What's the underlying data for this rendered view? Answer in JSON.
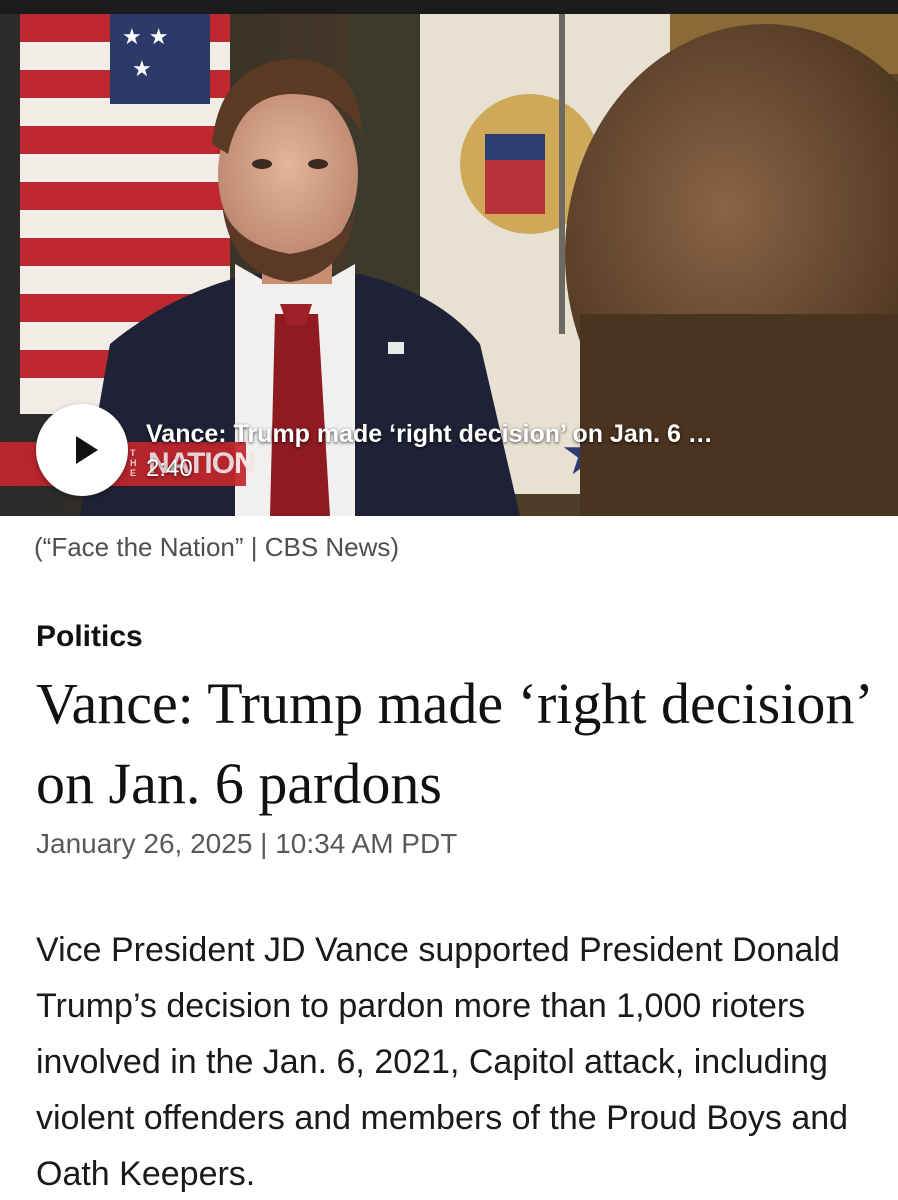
{
  "video": {
    "title": "Vance: Trump made ‘right decision’ on Jan. 6 …",
    "duration": "2:40",
    "network_bug": "NATION",
    "network_bug_small": "THE",
    "play_icon": "play-icon"
  },
  "caption": "(“Face the Nation” | CBS News)",
  "article": {
    "section": "Politics",
    "headline": "Vance: Trump made ‘right decision’ on Jan. 6 pardons",
    "byline": "January 26, 2025 | 10:34 AM PDT",
    "body": "Vice President JD Vance supported President Donald Trump’s decision to pardon more than 1,000 rioters involved in the Jan. 6, 2021, Capitol attack, including violent offenders and members of the Proud Boys and Oath Keepers."
  },
  "colors": {
    "network_red": "#c3262c",
    "headline": "#111111",
    "muted_text": "#595959"
  }
}
